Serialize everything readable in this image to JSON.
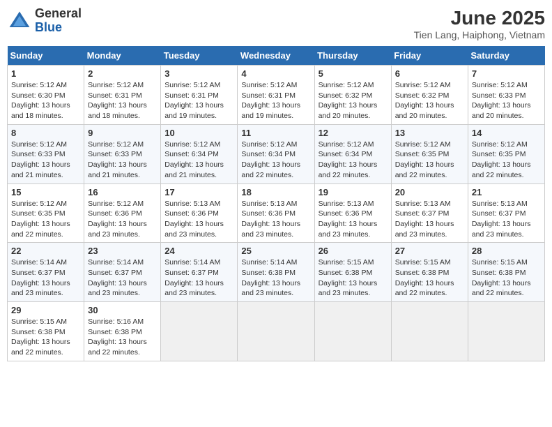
{
  "header": {
    "logo_general": "General",
    "logo_blue": "Blue",
    "month_year": "June 2025",
    "location": "Tien Lang, Haiphong, Vietnam"
  },
  "days_of_week": [
    "Sunday",
    "Monday",
    "Tuesday",
    "Wednesday",
    "Thursday",
    "Friday",
    "Saturday"
  ],
  "weeks": [
    [
      {
        "day": "1",
        "lines": [
          "Sunrise: 5:12 AM",
          "Sunset: 6:30 PM",
          "Daylight: 13 hours",
          "and 18 minutes."
        ]
      },
      {
        "day": "2",
        "lines": [
          "Sunrise: 5:12 AM",
          "Sunset: 6:31 PM",
          "Daylight: 13 hours",
          "and 18 minutes."
        ]
      },
      {
        "day": "3",
        "lines": [
          "Sunrise: 5:12 AM",
          "Sunset: 6:31 PM",
          "Daylight: 13 hours",
          "and 19 minutes."
        ]
      },
      {
        "day": "4",
        "lines": [
          "Sunrise: 5:12 AM",
          "Sunset: 6:31 PM",
          "Daylight: 13 hours",
          "and 19 minutes."
        ]
      },
      {
        "day": "5",
        "lines": [
          "Sunrise: 5:12 AM",
          "Sunset: 6:32 PM",
          "Daylight: 13 hours",
          "and 20 minutes."
        ]
      },
      {
        "day": "6",
        "lines": [
          "Sunrise: 5:12 AM",
          "Sunset: 6:32 PM",
          "Daylight: 13 hours",
          "and 20 minutes."
        ]
      },
      {
        "day": "7",
        "lines": [
          "Sunrise: 5:12 AM",
          "Sunset: 6:33 PM",
          "Daylight: 13 hours",
          "and 20 minutes."
        ]
      }
    ],
    [
      {
        "day": "8",
        "lines": [
          "Sunrise: 5:12 AM",
          "Sunset: 6:33 PM",
          "Daylight: 13 hours",
          "and 21 minutes."
        ]
      },
      {
        "day": "9",
        "lines": [
          "Sunrise: 5:12 AM",
          "Sunset: 6:33 PM",
          "Daylight: 13 hours",
          "and 21 minutes."
        ]
      },
      {
        "day": "10",
        "lines": [
          "Sunrise: 5:12 AM",
          "Sunset: 6:34 PM",
          "Daylight: 13 hours",
          "and 21 minutes."
        ]
      },
      {
        "day": "11",
        "lines": [
          "Sunrise: 5:12 AM",
          "Sunset: 6:34 PM",
          "Daylight: 13 hours",
          "and 22 minutes."
        ]
      },
      {
        "day": "12",
        "lines": [
          "Sunrise: 5:12 AM",
          "Sunset: 6:34 PM",
          "Daylight: 13 hours",
          "and 22 minutes."
        ]
      },
      {
        "day": "13",
        "lines": [
          "Sunrise: 5:12 AM",
          "Sunset: 6:35 PM",
          "Daylight: 13 hours",
          "and 22 minutes."
        ]
      },
      {
        "day": "14",
        "lines": [
          "Sunrise: 5:12 AM",
          "Sunset: 6:35 PM",
          "Daylight: 13 hours",
          "and 22 minutes."
        ]
      }
    ],
    [
      {
        "day": "15",
        "lines": [
          "Sunrise: 5:12 AM",
          "Sunset: 6:35 PM",
          "Daylight: 13 hours",
          "and 22 minutes."
        ]
      },
      {
        "day": "16",
        "lines": [
          "Sunrise: 5:12 AM",
          "Sunset: 6:36 PM",
          "Daylight: 13 hours",
          "and 23 minutes."
        ]
      },
      {
        "day": "17",
        "lines": [
          "Sunrise: 5:13 AM",
          "Sunset: 6:36 PM",
          "Daylight: 13 hours",
          "and 23 minutes."
        ]
      },
      {
        "day": "18",
        "lines": [
          "Sunrise: 5:13 AM",
          "Sunset: 6:36 PM",
          "Daylight: 13 hours",
          "and 23 minutes."
        ]
      },
      {
        "day": "19",
        "lines": [
          "Sunrise: 5:13 AM",
          "Sunset: 6:36 PM",
          "Daylight: 13 hours",
          "and 23 minutes."
        ]
      },
      {
        "day": "20",
        "lines": [
          "Sunrise: 5:13 AM",
          "Sunset: 6:37 PM",
          "Daylight: 13 hours",
          "and 23 minutes."
        ]
      },
      {
        "day": "21",
        "lines": [
          "Sunrise: 5:13 AM",
          "Sunset: 6:37 PM",
          "Daylight: 13 hours",
          "and 23 minutes."
        ]
      }
    ],
    [
      {
        "day": "22",
        "lines": [
          "Sunrise: 5:14 AM",
          "Sunset: 6:37 PM",
          "Daylight: 13 hours",
          "and 23 minutes."
        ]
      },
      {
        "day": "23",
        "lines": [
          "Sunrise: 5:14 AM",
          "Sunset: 6:37 PM",
          "Daylight: 13 hours",
          "and 23 minutes."
        ]
      },
      {
        "day": "24",
        "lines": [
          "Sunrise: 5:14 AM",
          "Sunset: 6:37 PM",
          "Daylight: 13 hours",
          "and 23 minutes."
        ]
      },
      {
        "day": "25",
        "lines": [
          "Sunrise: 5:14 AM",
          "Sunset: 6:38 PM",
          "Daylight: 13 hours",
          "and 23 minutes."
        ]
      },
      {
        "day": "26",
        "lines": [
          "Sunrise: 5:15 AM",
          "Sunset: 6:38 PM",
          "Daylight: 13 hours",
          "and 23 minutes."
        ]
      },
      {
        "day": "27",
        "lines": [
          "Sunrise: 5:15 AM",
          "Sunset: 6:38 PM",
          "Daylight: 13 hours",
          "and 22 minutes."
        ]
      },
      {
        "day": "28",
        "lines": [
          "Sunrise: 5:15 AM",
          "Sunset: 6:38 PM",
          "Daylight: 13 hours",
          "and 22 minutes."
        ]
      }
    ],
    [
      {
        "day": "29",
        "lines": [
          "Sunrise: 5:15 AM",
          "Sunset: 6:38 PM",
          "Daylight: 13 hours",
          "and 22 minutes."
        ]
      },
      {
        "day": "30",
        "lines": [
          "Sunrise: 5:16 AM",
          "Sunset: 6:38 PM",
          "Daylight: 13 hours",
          "and 22 minutes."
        ]
      },
      {
        "day": "",
        "lines": []
      },
      {
        "day": "",
        "lines": []
      },
      {
        "day": "",
        "lines": []
      },
      {
        "day": "",
        "lines": []
      },
      {
        "day": "",
        "lines": []
      }
    ]
  ]
}
